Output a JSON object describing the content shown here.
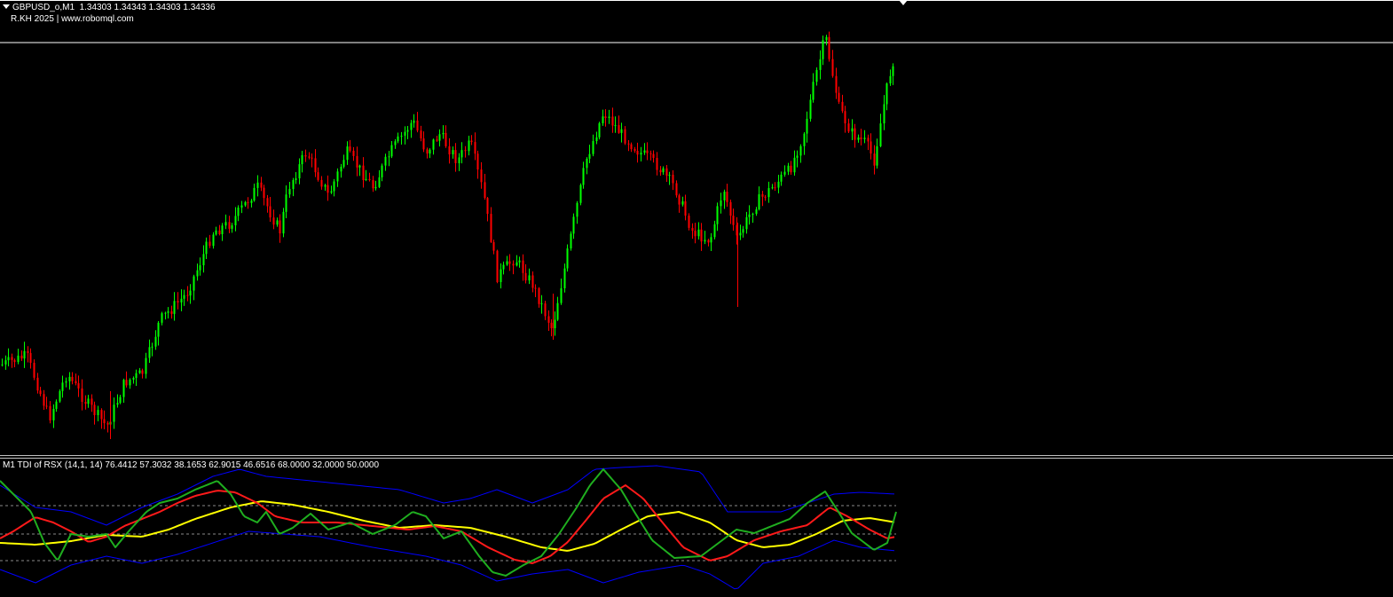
{
  "header": {
    "symbol": "GBPUSD_o,M1",
    "ohlc": "1.34303 1.34343 1.34303 1.34336",
    "brand": "R.KH 2025 | www.robomql.com"
  },
  "indicator": {
    "label": "M1 TDI of RSX (14,1, 14) 76.4412 57.3032 38.1653 62.9015 46.6516 68.0000 32.0000 50.0000"
  },
  "colors": {
    "bull": "#00ff00",
    "bear": "#ff0000",
    "rsx_line": "#1fae1f",
    "signal_line": "#ff1a1a",
    "market_base": "#ffff00",
    "bands": "#0000ff",
    "level": "#8a8a8a",
    "price_line": "#ffffff"
  }
}
